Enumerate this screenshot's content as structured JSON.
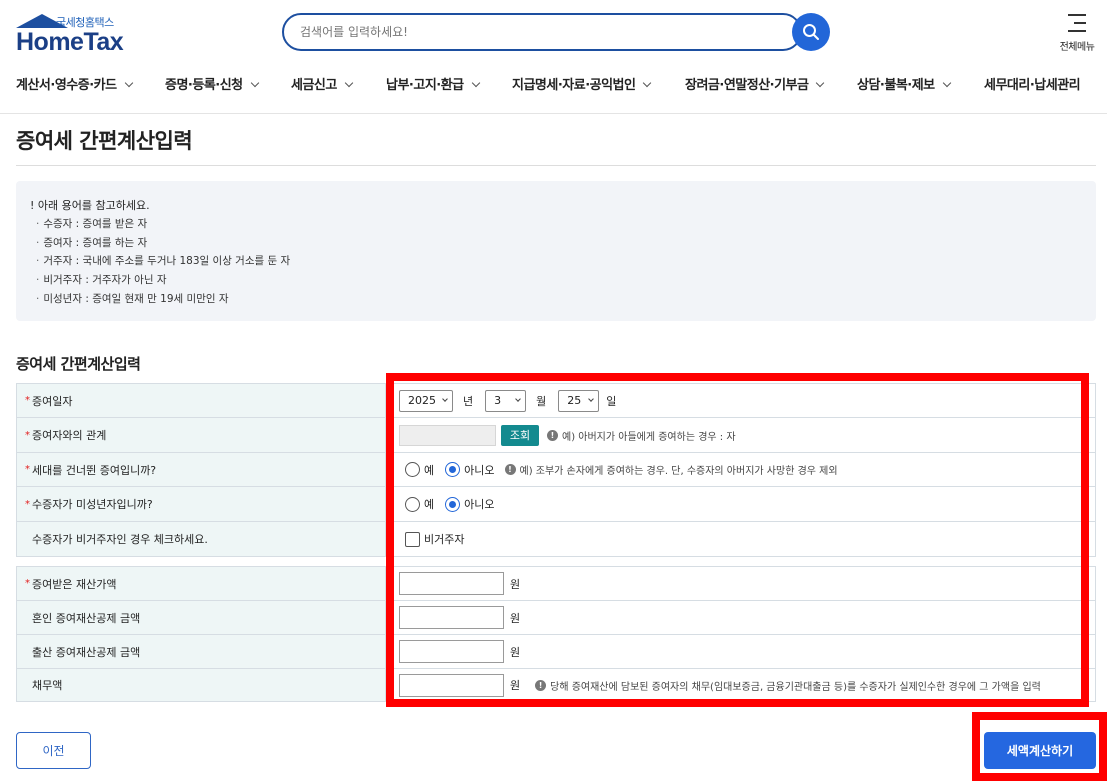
{
  "header": {
    "logo_sub": "국세청홈택스",
    "logo_main": "HomeTax",
    "search_placeholder": "검색어를 입력하세요!",
    "allmenu_label": "전체메뉴"
  },
  "nav": [
    {
      "label": "계산서·영수증·카드"
    },
    {
      "label": "증명·등록·신청"
    },
    {
      "label": "세금신고"
    },
    {
      "label": "납부·고지·환급"
    },
    {
      "label": "지급명세·자료·공익법인"
    },
    {
      "label": "장려금·연말정산·기부금"
    },
    {
      "label": "상담·불복·제보"
    },
    {
      "label": "세무대리·납세관리"
    }
  ],
  "page_title": "증여세 간편계산입력",
  "info": {
    "title": "! 아래 용어를 참고하세요.",
    "items": [
      "수증자 : 증여를 받은 자",
      "증여자 : 증여를 하는 자",
      "거주자 : 국내에 주소를 두거나 183일 이상 거소를 둔 자",
      "비거주자 : 거주자가 아닌 자",
      "미성년자 : 증여일 현재 만 19세 미만인 자"
    ]
  },
  "section_title": "증여세 간편계산입력",
  "form": {
    "gift_date": {
      "label": "증여일자",
      "year": "2025",
      "year_unit": "년",
      "month": "3",
      "month_unit": "월",
      "day": "25",
      "day_unit": "일"
    },
    "relation": {
      "label": "증여자와의 관계",
      "button": "조회",
      "hint": "예) 아버지가 아들에게 증여하는 경우 : 자"
    },
    "skip_generation": {
      "label": "세대를 건너뛴 증여입니까?",
      "yes": "예",
      "no": "아니오",
      "selected": "아니오",
      "hint": "예) 조부가 손자에게 증여하는 경우. 단, 수증자의 아버지가 사망한 경우 제외"
    },
    "minor": {
      "label": "수증자가 미성년자입니까?",
      "yes": "예",
      "no": "아니오",
      "selected": "아니오"
    },
    "nonresident": {
      "label": "수증자가 비거주자인 경우 체크하세요.",
      "check_label": "비거주자",
      "checked": false
    },
    "gift_amount": {
      "label": "증여받은 재산가액",
      "unit": "원",
      "value": ""
    },
    "marriage_deduction": {
      "label": "혼인 증여재산공제 금액",
      "unit": "원",
      "value": ""
    },
    "birth_deduction": {
      "label": "출산 증여재산공제 금액",
      "unit": "원",
      "value": ""
    },
    "debt": {
      "label": "채무액",
      "unit": "원",
      "value": "",
      "hint": "당해 증여재산에 담보된 증여자의 채무(임대보증금, 금융기관대출금 등)를 수증자가 실제인수한 경우에 그 가액을 입력"
    }
  },
  "buttons": {
    "prev": "이전",
    "calculate": "세액계산하기"
  },
  "colors": {
    "brand": "#1d4fa0",
    "accent": "#2567e0",
    "query_button": "#138a8f",
    "highlight": "#ff0000"
  }
}
